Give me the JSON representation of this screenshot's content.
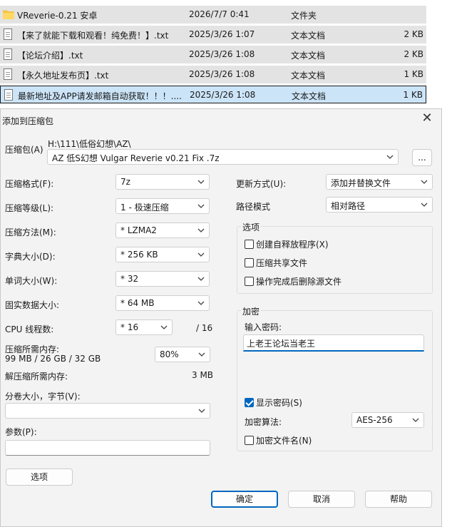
{
  "files": [
    {
      "icon": "folder-icon",
      "name": "VReverie-0.21 安卓",
      "date": "2026/7/7 0:41",
      "type": "文件夹",
      "size": ""
    },
    {
      "icon": "document-icon",
      "name": "【来了就能下载和观看！纯免费！】.txt",
      "date": "2025/3/26 1:07",
      "type": "文本文档",
      "size": "2 KB"
    },
    {
      "icon": "document-icon",
      "name": "【论坛介绍】.txt",
      "date": "2025/3/26 1:08",
      "type": "文本文档",
      "size": "2 KB"
    },
    {
      "icon": "document-icon",
      "name": "【永久地址发布页】.txt",
      "date": "2025/3/26 1:08",
      "type": "文本文档",
      "size": "1 KB"
    },
    {
      "icon": "document-icon",
      "name": "最新地址及APP请发邮箱自动获取！！！....",
      "date": "2025/3/26 1:08",
      "type": "文本文档",
      "size": "1 KB"
    }
  ],
  "dialog": {
    "title": "添加到压缩包",
    "close_glyph": "✕",
    "archive_label": "压缩包(A)",
    "archive_path": "H:\\111\\低俗幻想\\AZ\\",
    "archive_name": "AZ 低S幻想 Vulgar Reverie v0.21 Fix .7z",
    "browse_label": "...",
    "format_label": "压缩格式(F):",
    "format_value": "7z",
    "level_label": "压缩等级(L):",
    "level_value": "1 - 极速压缩",
    "method_label": "压缩方法(M):",
    "method_value": "*  LZMA2",
    "dict_label": "字典大小(D):",
    "dict_value": "*  256 KB",
    "word_label": "单词大小(W):",
    "word_value": "*  32",
    "solid_label": "固实数据大小:",
    "solid_value": "*  64 MB",
    "cpu_label": "CPU 线程数:",
    "cpu_value": "*  16",
    "cpu_total": "/ 16",
    "mem_label": "压缩所需内存:",
    "mem_detail": "99 MB / 26 GB / 32 GB",
    "mem_value": "80%",
    "decomp_label": "解压缩所需内存:",
    "decomp_value": "3 MB",
    "split_label": "分卷大小，字节(V):",
    "split_value": "",
    "params_label": "参数(P):",
    "params_value": "",
    "options_button": "选项",
    "update_label": "更新方式(U):",
    "update_value": "添加并替换文件",
    "path_label": "路径模式",
    "path_value": "相对路径",
    "options_group": "选项",
    "opt_sfx": "创建自释放程序(X)",
    "opt_shared": "压缩共享文件",
    "opt_delete": "操作完成后删除源文件",
    "encrypt_group": "加密",
    "password_label": "输入密码:",
    "password_value": "上老王论坛当老王",
    "show_password": "显示密码(S)",
    "enc_method_label": "加密算法:",
    "enc_method_value": "AES-256",
    "enc_names": "加密文件名(N)",
    "ok_button": "确定",
    "cancel_button": "取消",
    "help_button": "帮助"
  }
}
